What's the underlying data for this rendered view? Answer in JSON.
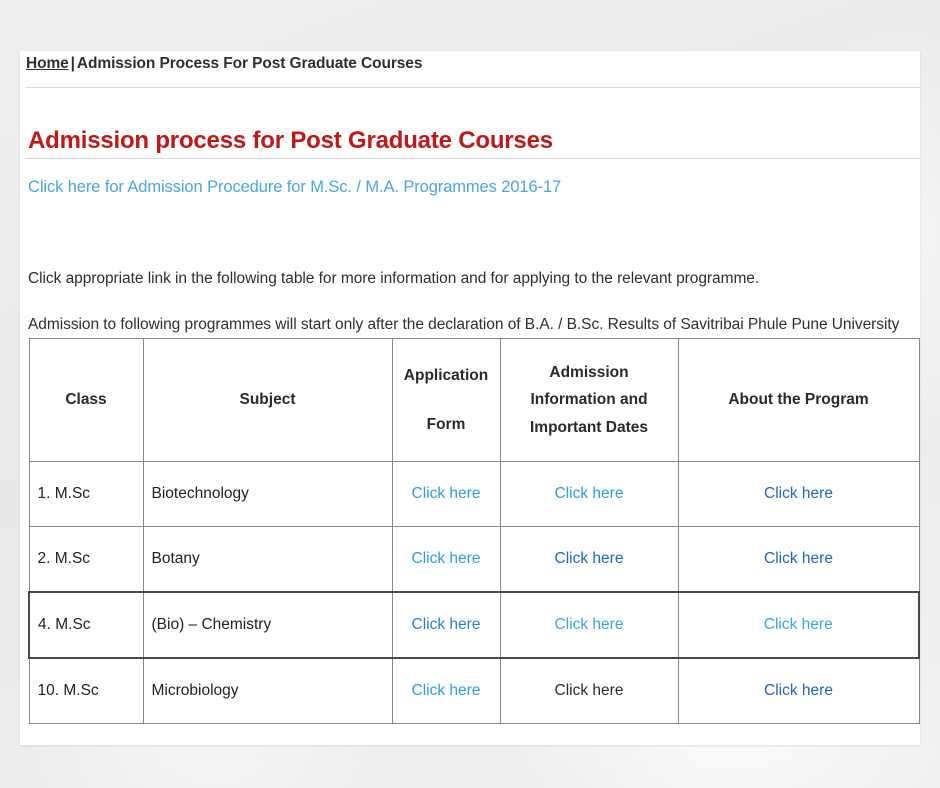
{
  "breadcrumb": {
    "home_label": "Home",
    "separator": "|",
    "current_label": "Admission Process For Post Graduate Courses"
  },
  "page_title": "Admission process for Post Graduate Courses",
  "intro_link": "Click here for Admission Procedure for M.Sc. / M.A. Programmes 2016-17",
  "paragraphs": {
    "p1": "Click appropriate link in the following table for more information and for applying to the relevant programme.",
    "p2": "Admission to following programmes will start only after the declaration of  B.A. / B.Sc. Results of Savitribai Phule Pune University"
  },
  "table": {
    "headers": {
      "class": "Class",
      "subject": "Subject",
      "application_form": "Application\nForm",
      "application_form_line1": "Application",
      "application_form_line2": "Form",
      "admission_info_line1": "Admission",
      "admission_info_line2": "Information and",
      "admission_info_line3": "Important Dates",
      "about_program": "About the Program"
    },
    "rows": [
      {
        "class": "1. M.Sc",
        "subject": "Biotechnology",
        "application_form": "Click here",
        "admission_info": "Click here",
        "about_program": "Click here",
        "application_form_is_link": true,
        "admission_info_is_link": true,
        "about_program_is_link": true,
        "application_form_color": "#2e9fd4",
        "admission_info_color": "#2e9fd4",
        "about_program_color": "#2166bb"
      },
      {
        "class": "2. M.Sc",
        "subject": "Botany",
        "application_form": "Click here",
        "admission_info": "Click here",
        "about_program": "Click here",
        "application_form_is_link": true,
        "admission_info_is_link": true,
        "about_program_is_link": true,
        "application_form_color": "#2e9fd4",
        "admission_info_color": "#2166bb",
        "about_program_color": "#2166bb"
      },
      {
        "class": "4. M.Sc",
        "subject": "(Bio) – Chemistry",
        "application_form": "Click here",
        "admission_info": "Click here",
        "about_program": "Click here",
        "application_form_is_link": true,
        "admission_info_is_link": true,
        "about_program_is_link": true,
        "application_form_color": "#2a7fc9",
        "admission_info_color": "#3aa8dd",
        "about_program_color": "#3aa8dd"
      },
      {
        "class": "10. M.Sc",
        "subject": "Microbiology",
        "application_form": "Click here",
        "admission_info": "Click here",
        "about_program": "Click here",
        "application_form_is_link": true,
        "admission_info_is_link": false,
        "about_program_is_link": true,
        "application_form_color": "#2e9fd4",
        "admission_info_color": "#2b2b2b",
        "about_program_color": "#2166bb"
      }
    ]
  },
  "colors": {
    "title_red": "#c01818",
    "link_cyan": "#4aa8d8",
    "link_blue": "#2166bb",
    "body_text": "#2e2e2e",
    "card_bg": "#ffffff",
    "page_bg": "#ececec",
    "table_border": "#888888"
  }
}
